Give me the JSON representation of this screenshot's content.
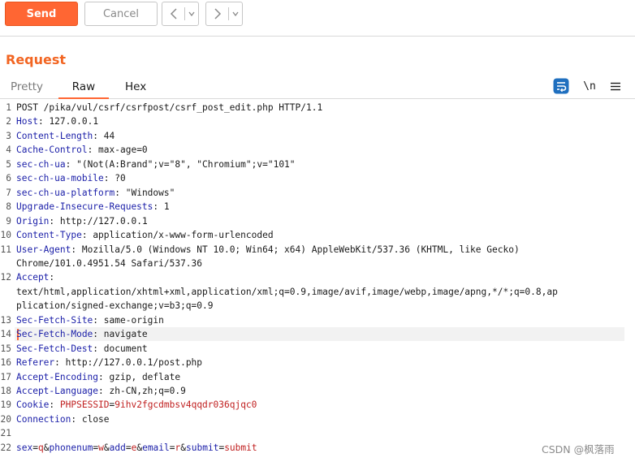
{
  "toolbar": {
    "send_label": "Send",
    "cancel_label": "Cancel",
    "back_icon": "chevron-left-icon",
    "forward_icon": "chevron-right-icon",
    "dropdown_icon": "chevron-down-icon"
  },
  "request": {
    "title": "Request",
    "tabs": [
      {
        "label": "Pretty",
        "selected": false
      },
      {
        "label": "Raw",
        "selected": true
      },
      {
        "label": "Hex",
        "selected": false
      }
    ],
    "tools": {
      "wrap_icon": "word-wrap-icon",
      "newline_label": "\\n",
      "menu_icon": "hamburger-menu-icon"
    }
  },
  "editor": {
    "lines": [
      {
        "n": "1",
        "name": "",
        "value": "POST /pika/vul/csrf/csrfpost/csrf_post_edit.php HTTP/1.1"
      },
      {
        "n": "2",
        "name": "Host",
        "value": "127.0.0.1"
      },
      {
        "n": "3",
        "name": "Content-Length",
        "value": "44"
      },
      {
        "n": "4",
        "name": "Cache-Control",
        "value": "max-age=0"
      },
      {
        "n": "5",
        "name": "sec-ch-ua",
        "value": "\"(Not(A:Brand\";v=\"8\", \"Chromium\";v=\"101\""
      },
      {
        "n": "6",
        "name": "sec-ch-ua-mobile",
        "value": "?0"
      },
      {
        "n": "7",
        "name": "sec-ch-ua-platform",
        "value": "\"Windows\""
      },
      {
        "n": "8",
        "name": "Upgrade-Insecure-Requests",
        "value": "1"
      },
      {
        "n": "9",
        "name": "Origin",
        "value": "http://127.0.0.1"
      },
      {
        "n": "10",
        "name": "Content-Type",
        "value": "application/x-www-form-urlencoded"
      },
      {
        "n": "11",
        "name": "User-Agent",
        "value": "Mozilla/5.0 (Windows NT 10.0; Win64; x64) AppleWebKit/537.36 (KHTML, like Gecko)",
        "cont": "Chrome/101.0.4951.54 Safari/537.36"
      },
      {
        "n": "12",
        "name": "Accept",
        "value": "",
        "cont": "text/html,application/xhtml+xml,application/xml;q=0.9,image/avif,image/webp,image/apng,*/*;q=0.8,ap",
        "cont2": "plication/signed-exchange;v=b3;q=0.9"
      },
      {
        "n": "13",
        "name": "Sec-Fetch-Site",
        "value": "same-origin"
      },
      {
        "n": "14",
        "name": "Sec-Fetch-Mode",
        "value": "navigate"
      },
      {
        "n": "15",
        "name": "Sec-Fetch-Dest",
        "value": "document"
      },
      {
        "n": "16",
        "name": "Referer",
        "value": "http://127.0.0.1/post.php"
      },
      {
        "n": "17",
        "name": "Accept-Encoding",
        "value": "gzip, deflate"
      },
      {
        "n": "18",
        "name": "Accept-Language",
        "value": "zh-CN,zh;q=0.9"
      },
      {
        "n": "19",
        "name": "Cookie",
        "value": "",
        "cookie_name": "PHPSESSID",
        "cookie_value": "9ihv2fgcdmbsv4qqdr036qjqc0"
      },
      {
        "n": "20",
        "name": "Connection",
        "value": "close"
      },
      {
        "n": "21",
        "name": "",
        "value": ""
      }
    ],
    "body_line_number": "22",
    "body_params": [
      {
        "name": "sex",
        "value": "q"
      },
      {
        "name": "phonenum",
        "value": "w"
      },
      {
        "name": "add",
        "value": "e"
      },
      {
        "name": "email",
        "value": "r"
      },
      {
        "name": "submit",
        "value": "submit"
      }
    ]
  },
  "watermark": "CSDN @枫落雨",
  "colors": {
    "accent": "#ff6633",
    "header_name": "#1a1ea8",
    "value_red": "#c02020"
  }
}
